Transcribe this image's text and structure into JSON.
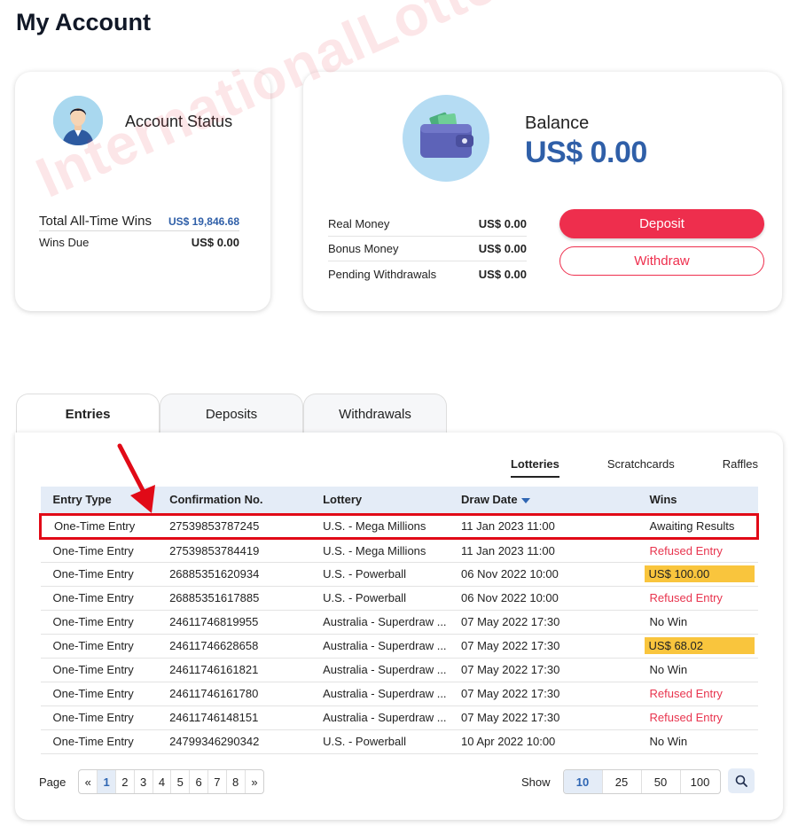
{
  "page": {
    "title": "My Account"
  },
  "status": {
    "title": "Account Status",
    "total_wins_label": "Total All-Time Wins",
    "total_wins_value": "US$ 19,846.68",
    "wins_due_label": "Wins Due",
    "wins_due_value": "US$ 0.00"
  },
  "balance": {
    "label": "Balance",
    "value": "US$ 0.00",
    "rows": [
      {
        "label": "Real Money",
        "value": "US$ 0.00"
      },
      {
        "label": "Bonus Money",
        "value": "US$ 0.00"
      },
      {
        "label": "Pending Withdrawals",
        "value": "US$ 0.00"
      }
    ],
    "deposit_label": "Deposit",
    "withdraw_label": "Withdraw"
  },
  "watermark": "InternationalLottery.org",
  "tabs": [
    "Entries",
    "Deposits",
    "Withdrawals"
  ],
  "subtabs": [
    "Lotteries",
    "Scratchcards",
    "Raffles"
  ],
  "table": {
    "headers": [
      "Entry Type",
      "Confirmation No.",
      "Lottery",
      "Draw Date",
      "Wins"
    ],
    "rows": [
      [
        "One-Time Entry",
        "27539853787245",
        "U.S. - Mega Millions",
        "11 Jan 2023 11:00",
        "Awaiting Results"
      ],
      [
        "One-Time Entry",
        "27539853784419",
        "U.S. - Mega Millions",
        "11 Jan 2023 11:00",
        "Refused Entry"
      ],
      [
        "One-Time Entry",
        "26885351620934",
        "U.S. - Powerball",
        "06 Nov 2022 10:00",
        "US$ 100.00"
      ],
      [
        "One-Time Entry",
        "26885351617885",
        "U.S. - Powerball",
        "06 Nov 2022 10:00",
        "Refused Entry"
      ],
      [
        "One-Time Entry",
        "24611746819955",
        "Australia - Superdraw ...",
        "07 May 2022 17:30",
        "No Win"
      ],
      [
        "One-Time Entry",
        "24611746628658",
        "Australia - Superdraw ...",
        "07 May 2022 17:30",
        "US$ 68.02"
      ],
      [
        "One-Time Entry",
        "24611746161821",
        "Australia - Superdraw ...",
        "07 May 2022 17:30",
        "No Win"
      ],
      [
        "One-Time Entry",
        "24611746161780",
        "Australia - Superdraw ...",
        "07 May 2022 17:30",
        "Refused Entry"
      ],
      [
        "One-Time Entry",
        "24611746148151",
        "Australia - Superdraw ...",
        "07 May 2022 17:30",
        "Refused Entry"
      ],
      [
        "One-Time Entry",
        "24799346290342",
        "U.S. - Powerball",
        "10 Apr 2022 10:00",
        "No Win"
      ]
    ]
  },
  "pager": {
    "label": "Page",
    "first": "«",
    "pages": [
      "1",
      "2",
      "3",
      "4",
      "5",
      "6",
      "7",
      "8"
    ],
    "last": "»"
  },
  "show": {
    "label": "Show",
    "sizes": [
      "10",
      "25",
      "50",
      "100"
    ]
  },
  "colors": {
    "accent_red": "#ee2e4d",
    "link_blue": "#2f5fa8",
    "win_yellow": "#f9c53d",
    "header_blue": "#e4ecf7"
  }
}
